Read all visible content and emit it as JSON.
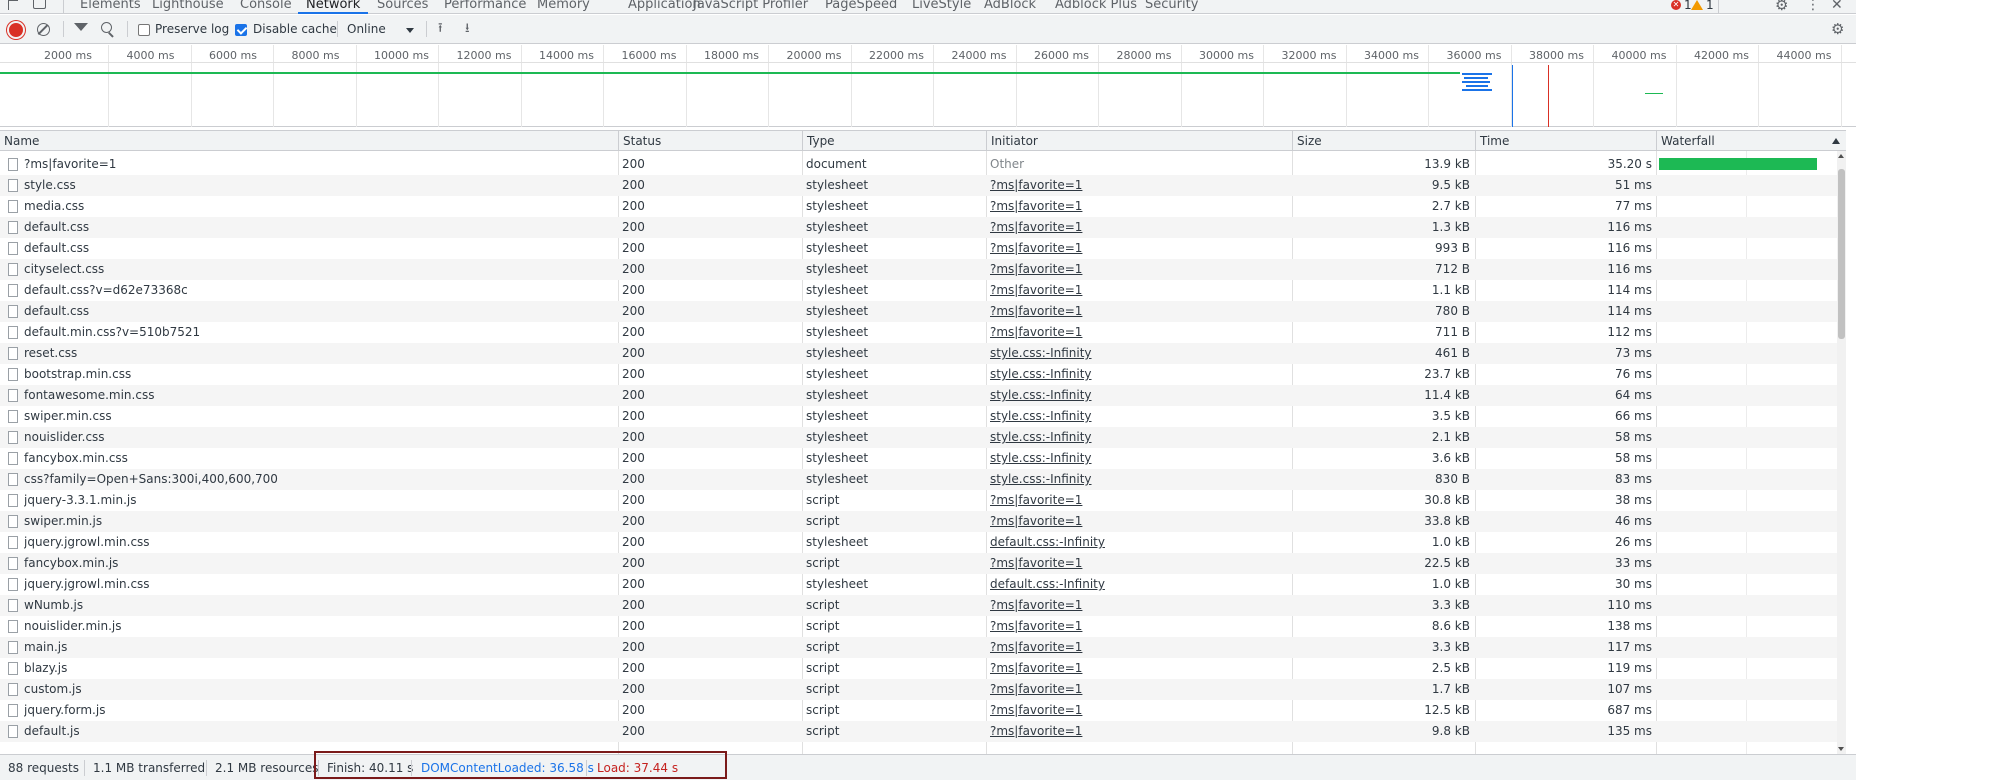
{
  "tabs": [
    {
      "label": "Elements",
      "active": false
    },
    {
      "label": "Lighthouse",
      "active": false
    },
    {
      "label": "Console",
      "active": false
    },
    {
      "label": "Network",
      "active": true
    },
    {
      "label": "Sources",
      "active": false
    },
    {
      "label": "Performance",
      "active": false
    },
    {
      "label": "Memory",
      "active": false
    },
    {
      "label": "Application",
      "active": false
    },
    {
      "label": "JavaScript Profiler",
      "active": false
    },
    {
      "label": "PageSpeed",
      "active": false
    },
    {
      "label": "LiveStyle",
      "active": false
    },
    {
      "label": "AdBlock",
      "active": false
    },
    {
      "label": "Adblock Plus",
      "active": false
    },
    {
      "label": "Security",
      "active": false
    }
  ],
  "issues": {
    "errors": "1",
    "warnings": "1"
  },
  "toolbar": {
    "preserve_log_label": "Preserve log",
    "preserve_log_checked": false,
    "disable_cache_label": "Disable cache",
    "disable_cache_checked": true,
    "throttling": "Online"
  },
  "overview": {
    "ticks": [
      "2000 ms",
      "4000 ms",
      "6000 ms",
      "8000 ms",
      "10000 ms",
      "12000 ms",
      "14000 ms",
      "16000 ms",
      "18000 ms",
      "20000 ms",
      "22000 ms",
      "24000 ms",
      "26000 ms",
      "28000 ms",
      "30000 ms",
      "32000 ms",
      "34000 ms",
      "36000 ms",
      "38000 ms",
      "40000 ms",
      "42000 ms",
      "44000 ms"
    ]
  },
  "columns": {
    "name": "Name",
    "status": "Status",
    "type": "Type",
    "initiator": "Initiator",
    "size": "Size",
    "time": "Time",
    "waterfall": "Waterfall"
  },
  "requests": [
    {
      "name": "?ms|favorite=1",
      "status": "200",
      "type": "document",
      "initiator": "Other",
      "size": "13.9 kB",
      "time": "35.20 s"
    },
    {
      "name": "style.css",
      "status": "200",
      "type": "stylesheet",
      "initiator": "?ms|favorite=1",
      "size": "9.5 kB",
      "time": "51 ms"
    },
    {
      "name": "media.css",
      "status": "200",
      "type": "stylesheet",
      "initiator": "?ms|favorite=1",
      "size": "2.7 kB",
      "time": "77 ms"
    },
    {
      "name": "default.css",
      "status": "200",
      "type": "stylesheet",
      "initiator": "?ms|favorite=1",
      "size": "1.3 kB",
      "time": "116 ms"
    },
    {
      "name": "default.css",
      "status": "200",
      "type": "stylesheet",
      "initiator": "?ms|favorite=1",
      "size": "993 B",
      "time": "116 ms"
    },
    {
      "name": "cityselect.css",
      "status": "200",
      "type": "stylesheet",
      "initiator": "?ms|favorite=1",
      "size": "712 B",
      "time": "116 ms"
    },
    {
      "name": "default.css?v=d62e73368c",
      "status": "200",
      "type": "stylesheet",
      "initiator": "?ms|favorite=1",
      "size": "1.1 kB",
      "time": "114 ms"
    },
    {
      "name": "default.css",
      "status": "200",
      "type": "stylesheet",
      "initiator": "?ms|favorite=1",
      "size": "780 B",
      "time": "114 ms"
    },
    {
      "name": "default.min.css?v=510b7521",
      "status": "200",
      "type": "stylesheet",
      "initiator": "?ms|favorite=1",
      "size": "711 B",
      "time": "112 ms"
    },
    {
      "name": "reset.css",
      "status": "200",
      "type": "stylesheet",
      "initiator": "style.css:-Infinity",
      "size": "461 B",
      "time": "73 ms"
    },
    {
      "name": "bootstrap.min.css",
      "status": "200",
      "type": "stylesheet",
      "initiator": "style.css:-Infinity",
      "size": "23.7 kB",
      "time": "76 ms"
    },
    {
      "name": "fontawesome.min.css",
      "status": "200",
      "type": "stylesheet",
      "initiator": "style.css:-Infinity",
      "size": "11.4 kB",
      "time": "64 ms"
    },
    {
      "name": "swiper.min.css",
      "status": "200",
      "type": "stylesheet",
      "initiator": "style.css:-Infinity",
      "size": "3.5 kB",
      "time": "66 ms"
    },
    {
      "name": "nouislider.css",
      "status": "200",
      "type": "stylesheet",
      "initiator": "style.css:-Infinity",
      "size": "2.1 kB",
      "time": "58 ms"
    },
    {
      "name": "fancybox.min.css",
      "status": "200",
      "type": "stylesheet",
      "initiator": "style.css:-Infinity",
      "size": "3.6 kB",
      "time": "58 ms"
    },
    {
      "name": "css?family=Open+Sans:300i,400,600,700",
      "status": "200",
      "type": "stylesheet",
      "initiator": "style.css:-Infinity",
      "size": "830 B",
      "time": "83 ms"
    },
    {
      "name": "jquery-3.3.1.min.js",
      "status": "200",
      "type": "script",
      "initiator": "?ms|favorite=1",
      "size": "30.8 kB",
      "time": "38 ms"
    },
    {
      "name": "swiper.min.js",
      "status": "200",
      "type": "script",
      "initiator": "?ms|favorite=1",
      "size": "33.8 kB",
      "time": "46 ms"
    },
    {
      "name": "jquery.jgrowl.min.css",
      "status": "200",
      "type": "stylesheet",
      "initiator": "default.css:-Infinity",
      "size": "1.0 kB",
      "time": "26 ms"
    },
    {
      "name": "fancybox.min.js",
      "status": "200",
      "type": "script",
      "initiator": "?ms|favorite=1",
      "size": "22.5 kB",
      "time": "33 ms"
    },
    {
      "name": "jquery.jgrowl.min.css",
      "status": "200",
      "type": "stylesheet",
      "initiator": "default.css:-Infinity",
      "size": "1.0 kB",
      "time": "30 ms"
    },
    {
      "name": "wNumb.js",
      "status": "200",
      "type": "script",
      "initiator": "?ms|favorite=1",
      "size": "3.3 kB",
      "time": "110 ms"
    },
    {
      "name": "nouislider.min.js",
      "status": "200",
      "type": "script",
      "initiator": "?ms|favorite=1",
      "size": "8.6 kB",
      "time": "138 ms"
    },
    {
      "name": "main.js",
      "status": "200",
      "type": "script",
      "initiator": "?ms|favorite=1",
      "size": "3.3 kB",
      "time": "117 ms"
    },
    {
      "name": "blazy.js",
      "status": "200",
      "type": "script",
      "initiator": "?ms|favorite=1",
      "size": "2.5 kB",
      "time": "119 ms"
    },
    {
      "name": "custom.js",
      "status": "200",
      "type": "script",
      "initiator": "?ms|favorite=1",
      "size": "1.7 kB",
      "time": "107 ms"
    },
    {
      "name": "jquery.form.js",
      "status": "200",
      "type": "script",
      "initiator": "?ms|favorite=1",
      "size": "12.5 kB",
      "time": "687 ms"
    },
    {
      "name": "default.js",
      "status": "200",
      "type": "script",
      "initiator": "?ms|favorite=1",
      "size": "9.8 kB",
      "time": "135 ms"
    }
  ],
  "summary": {
    "requests": "88 requests",
    "transferred": "1.1 MB transferred",
    "resources": "2.1 MB resources",
    "finish": "Finish: 40.11 s",
    "dom_content_loaded": "DOMContentLoaded: 36.58 s",
    "load": "Load: 37.44 s"
  },
  "colors": {
    "accent": "#1a73e8",
    "record": "#d93025",
    "dcl": "#1a73e8",
    "load": "#d93025",
    "waterfall_bar": "#1db954"
  }
}
